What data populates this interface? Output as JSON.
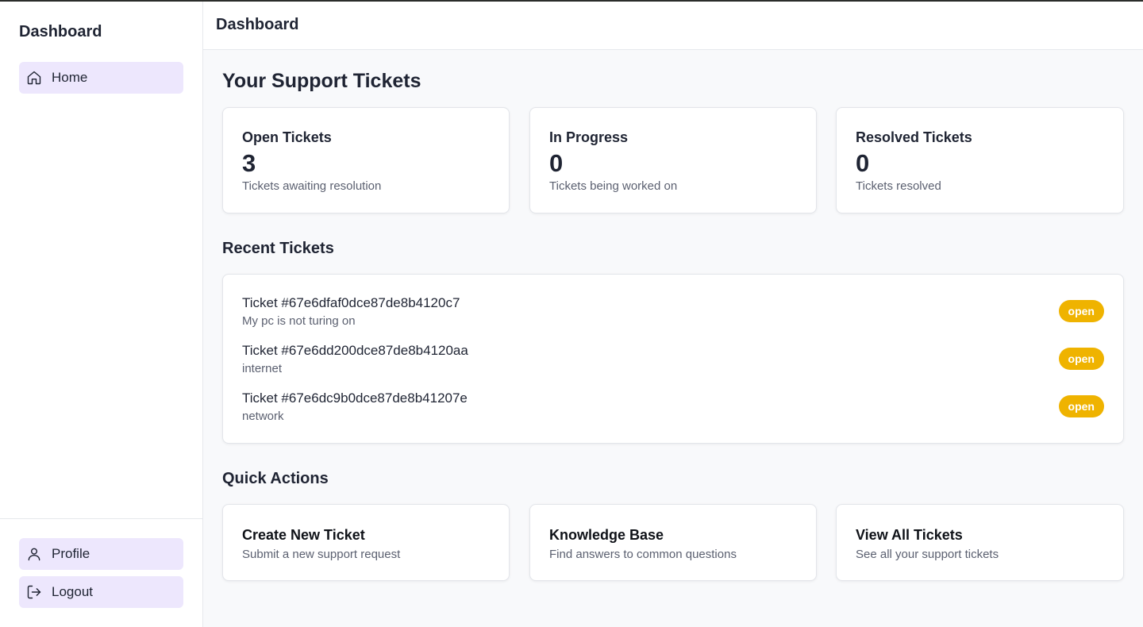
{
  "sidebar": {
    "title": "Dashboard",
    "nav": [
      {
        "label": "Home",
        "icon": "home-icon"
      }
    ],
    "bottom": [
      {
        "label": "Profile",
        "icon": "user-icon"
      },
      {
        "label": "Logout",
        "icon": "logout-icon"
      }
    ]
  },
  "header": {
    "title": "Dashboard"
  },
  "main": {
    "page_title": "Your Support Tickets",
    "stats": [
      {
        "label": "Open Tickets",
        "value": "3",
        "description": "Tickets awaiting resolution"
      },
      {
        "label": "In Progress",
        "value": "0",
        "description": "Tickets being worked on"
      },
      {
        "label": "Resolved Tickets",
        "value": "0",
        "description": "Tickets resolved"
      }
    ],
    "recent_title": "Recent Tickets",
    "recent_tickets": [
      {
        "id": "Ticket #67e6dfaf0dce87de8b4120c7",
        "subject": "My pc is not turing on",
        "status": "open"
      },
      {
        "id": "Ticket #67e6dd200dce87de8b4120aa",
        "subject": "internet",
        "status": "open"
      },
      {
        "id": "Ticket #67e6dc9b0dce87de8b41207e",
        "subject": "network",
        "status": "open"
      }
    ],
    "quick_title": "Quick Actions",
    "quick_actions": [
      {
        "title": "Create New Ticket",
        "description": "Submit a new support request"
      },
      {
        "title": "Knowledge Base",
        "description": "Find answers to common questions"
      },
      {
        "title": "View All Tickets",
        "description": "See all your support tickets"
      }
    ]
  },
  "colors": {
    "nav_active_bg": "#ede7fd",
    "badge_open": "#efb300",
    "text_primary": "#1f2433",
    "text_muted": "#5b6070"
  }
}
